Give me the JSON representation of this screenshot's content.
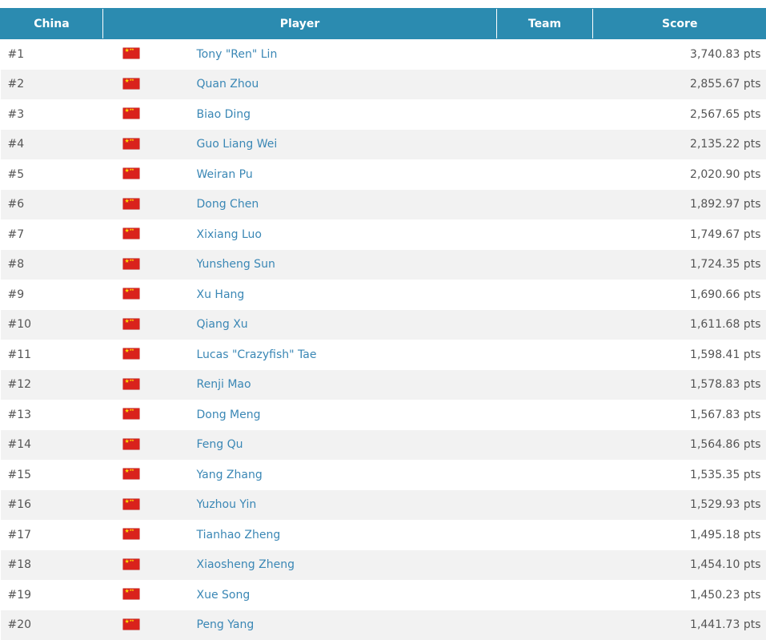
{
  "table": {
    "headers": {
      "china": "China",
      "player": "Player",
      "team": "Team",
      "score": "Score"
    },
    "flag_icon": "china-flag-icon",
    "header_color": "#2b8bb0",
    "link_color": "#3a87b5",
    "rows": [
      {
        "rank": "#1",
        "player": "Tony \"Ren\" Lin",
        "team": "",
        "score": "3,740.83 pts"
      },
      {
        "rank": "#2",
        "player": "Quan Zhou",
        "team": "",
        "score": "2,855.67 pts"
      },
      {
        "rank": "#3",
        "player": "Biao Ding",
        "team": "",
        "score": "2,567.65 pts"
      },
      {
        "rank": "#4",
        "player": "Guo Liang Wei",
        "team": "",
        "score": "2,135.22 pts"
      },
      {
        "rank": "#5",
        "player": "Weiran Pu",
        "team": "",
        "score": "2,020.90 pts"
      },
      {
        "rank": "#6",
        "player": "Dong Chen",
        "team": "",
        "score": "1,892.97 pts"
      },
      {
        "rank": "#7",
        "player": "Xixiang Luo",
        "team": "",
        "score": "1,749.67 pts"
      },
      {
        "rank": "#8",
        "player": "Yunsheng Sun",
        "team": "",
        "score": "1,724.35 pts"
      },
      {
        "rank": "#9",
        "player": "Xu Hang",
        "team": "",
        "score": "1,690.66 pts"
      },
      {
        "rank": "#10",
        "player": "Qiang Xu",
        "team": "",
        "score": "1,611.68 pts"
      },
      {
        "rank": "#11",
        "player": "Lucas \"Crazyfish\" Tae",
        "team": "",
        "score": "1,598.41 pts"
      },
      {
        "rank": "#12",
        "player": "Renji Mao",
        "team": "",
        "score": "1,578.83 pts"
      },
      {
        "rank": "#13",
        "player": "Dong Meng",
        "team": "",
        "score": "1,567.83 pts"
      },
      {
        "rank": "#14",
        "player": "Feng Qu",
        "team": "",
        "score": "1,564.86 pts"
      },
      {
        "rank": "#15",
        "player": "Yang Zhang",
        "team": "",
        "score": "1,535.35 pts"
      },
      {
        "rank": "#16",
        "player": "Yuzhou Yin",
        "team": "",
        "score": "1,529.93 pts"
      },
      {
        "rank": "#17",
        "player": "Tianhao Zheng",
        "team": "",
        "score": "1,495.18 pts"
      },
      {
        "rank": "#18",
        "player": "Xiaosheng Zheng",
        "team": "",
        "score": "1,454.10 pts"
      },
      {
        "rank": "#19",
        "player": "Xue Song",
        "team": "",
        "score": "1,450.23 pts"
      },
      {
        "rank": "#20",
        "player": "Peng Yang",
        "team": "",
        "score": "1,441.73 pts"
      }
    ]
  }
}
